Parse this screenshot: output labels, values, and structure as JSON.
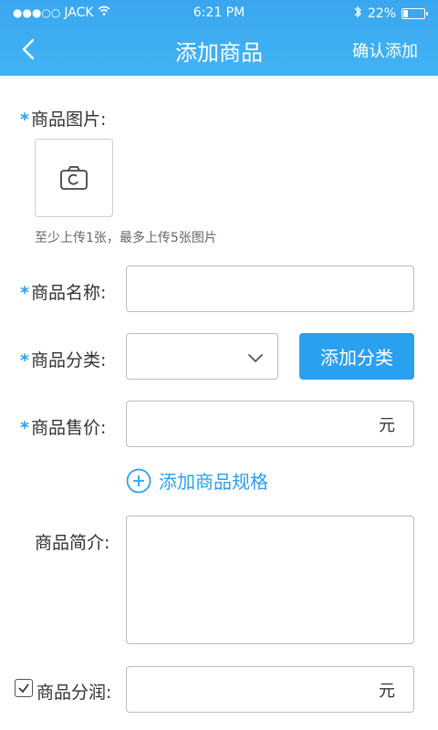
{
  "status_bar": {
    "signal": "●●●○○",
    "carrier": "JACK",
    "time": "6:21 PM",
    "battery_percent": "22%",
    "battery_level": 0.22
  },
  "nav": {
    "back_icon": "chevron-left-icon",
    "title": "添加商品",
    "confirm_label": "确认添加"
  },
  "form": {
    "product_images_label": "商品图片:",
    "camera_icon": "camera-icon",
    "images_hint": "至少上传1张，最多上传5张图片",
    "product_name_label": "商品名称:",
    "product_name_value": "",
    "category_label": "商品分类:",
    "category_value": "",
    "add_category_label": "添加分类",
    "price_label": "商品售价:",
    "price_value": "",
    "price_suffix": "元",
    "add_spec_label": "添加商品规格",
    "intro_label": "商品简介:",
    "intro_value": "",
    "profit_share_label": "商品分润:",
    "profit_share_value": "",
    "profit_share_suffix": "元",
    "profit_share_checked": true
  },
  "colors": {
    "accent": "#2aa0f0",
    "header": "#3aa6ef"
  }
}
